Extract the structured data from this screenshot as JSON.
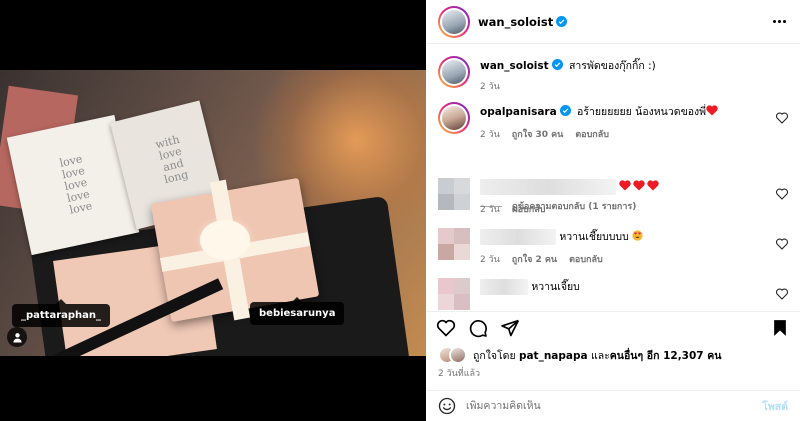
{
  "post": {
    "author": "wan_soloist",
    "caption": "สารพัดของกุ๊กกิ๊ก :)",
    "caption_age": "2 วัน"
  },
  "media": {
    "tags": [
      "_pattaraphan_",
      "bebiesarunya"
    ],
    "card1_text": "love\nlove\nlove\nlove\nlove",
    "card2_text": "with\nlove\nand\nlong"
  },
  "comments": [
    {
      "username": "opalpanisara",
      "text": "อร้ายยยยยย น้องหนวดของพี่",
      "age": "2 วัน",
      "likes": "ถูกใจ 30 คน",
      "reply": "ตอบกลับ",
      "view_replies": "ดูข้อความตอบกลับ (1 รายการ)"
    },
    {
      "age": "2 วัน",
      "reply": "ตอบกลับ"
    },
    {
      "text": "หวานเชี๊ยบบบบ",
      "age": "2 วัน",
      "likes": "ถูกใจ 2 คน",
      "reply": "ตอบกลับ"
    },
    {
      "text": "หวานเจี๊ยบ"
    }
  ],
  "likes": {
    "prefix": "ถูกใจโดย",
    "user": "pat_napapa",
    "middle": "และ",
    "others": "คนอื่นๆ อีก 12,307 คน"
  },
  "time_ago": "2 วันที่แล้ว",
  "add_comment": {
    "placeholder": "เพิ่มความคิดเห็น",
    "post_label": "โพสต์"
  },
  "colors": {
    "verified": "#0095f6",
    "heart": "#ed1c24",
    "post_disabled": "#b2dffc",
    "muted": "#737373"
  },
  "icons": [
    "more-icon",
    "verified-icon",
    "heart-icon",
    "comment-icon",
    "share-icon",
    "bookmark-icon",
    "emoji-icon",
    "user-tag-icon"
  ]
}
